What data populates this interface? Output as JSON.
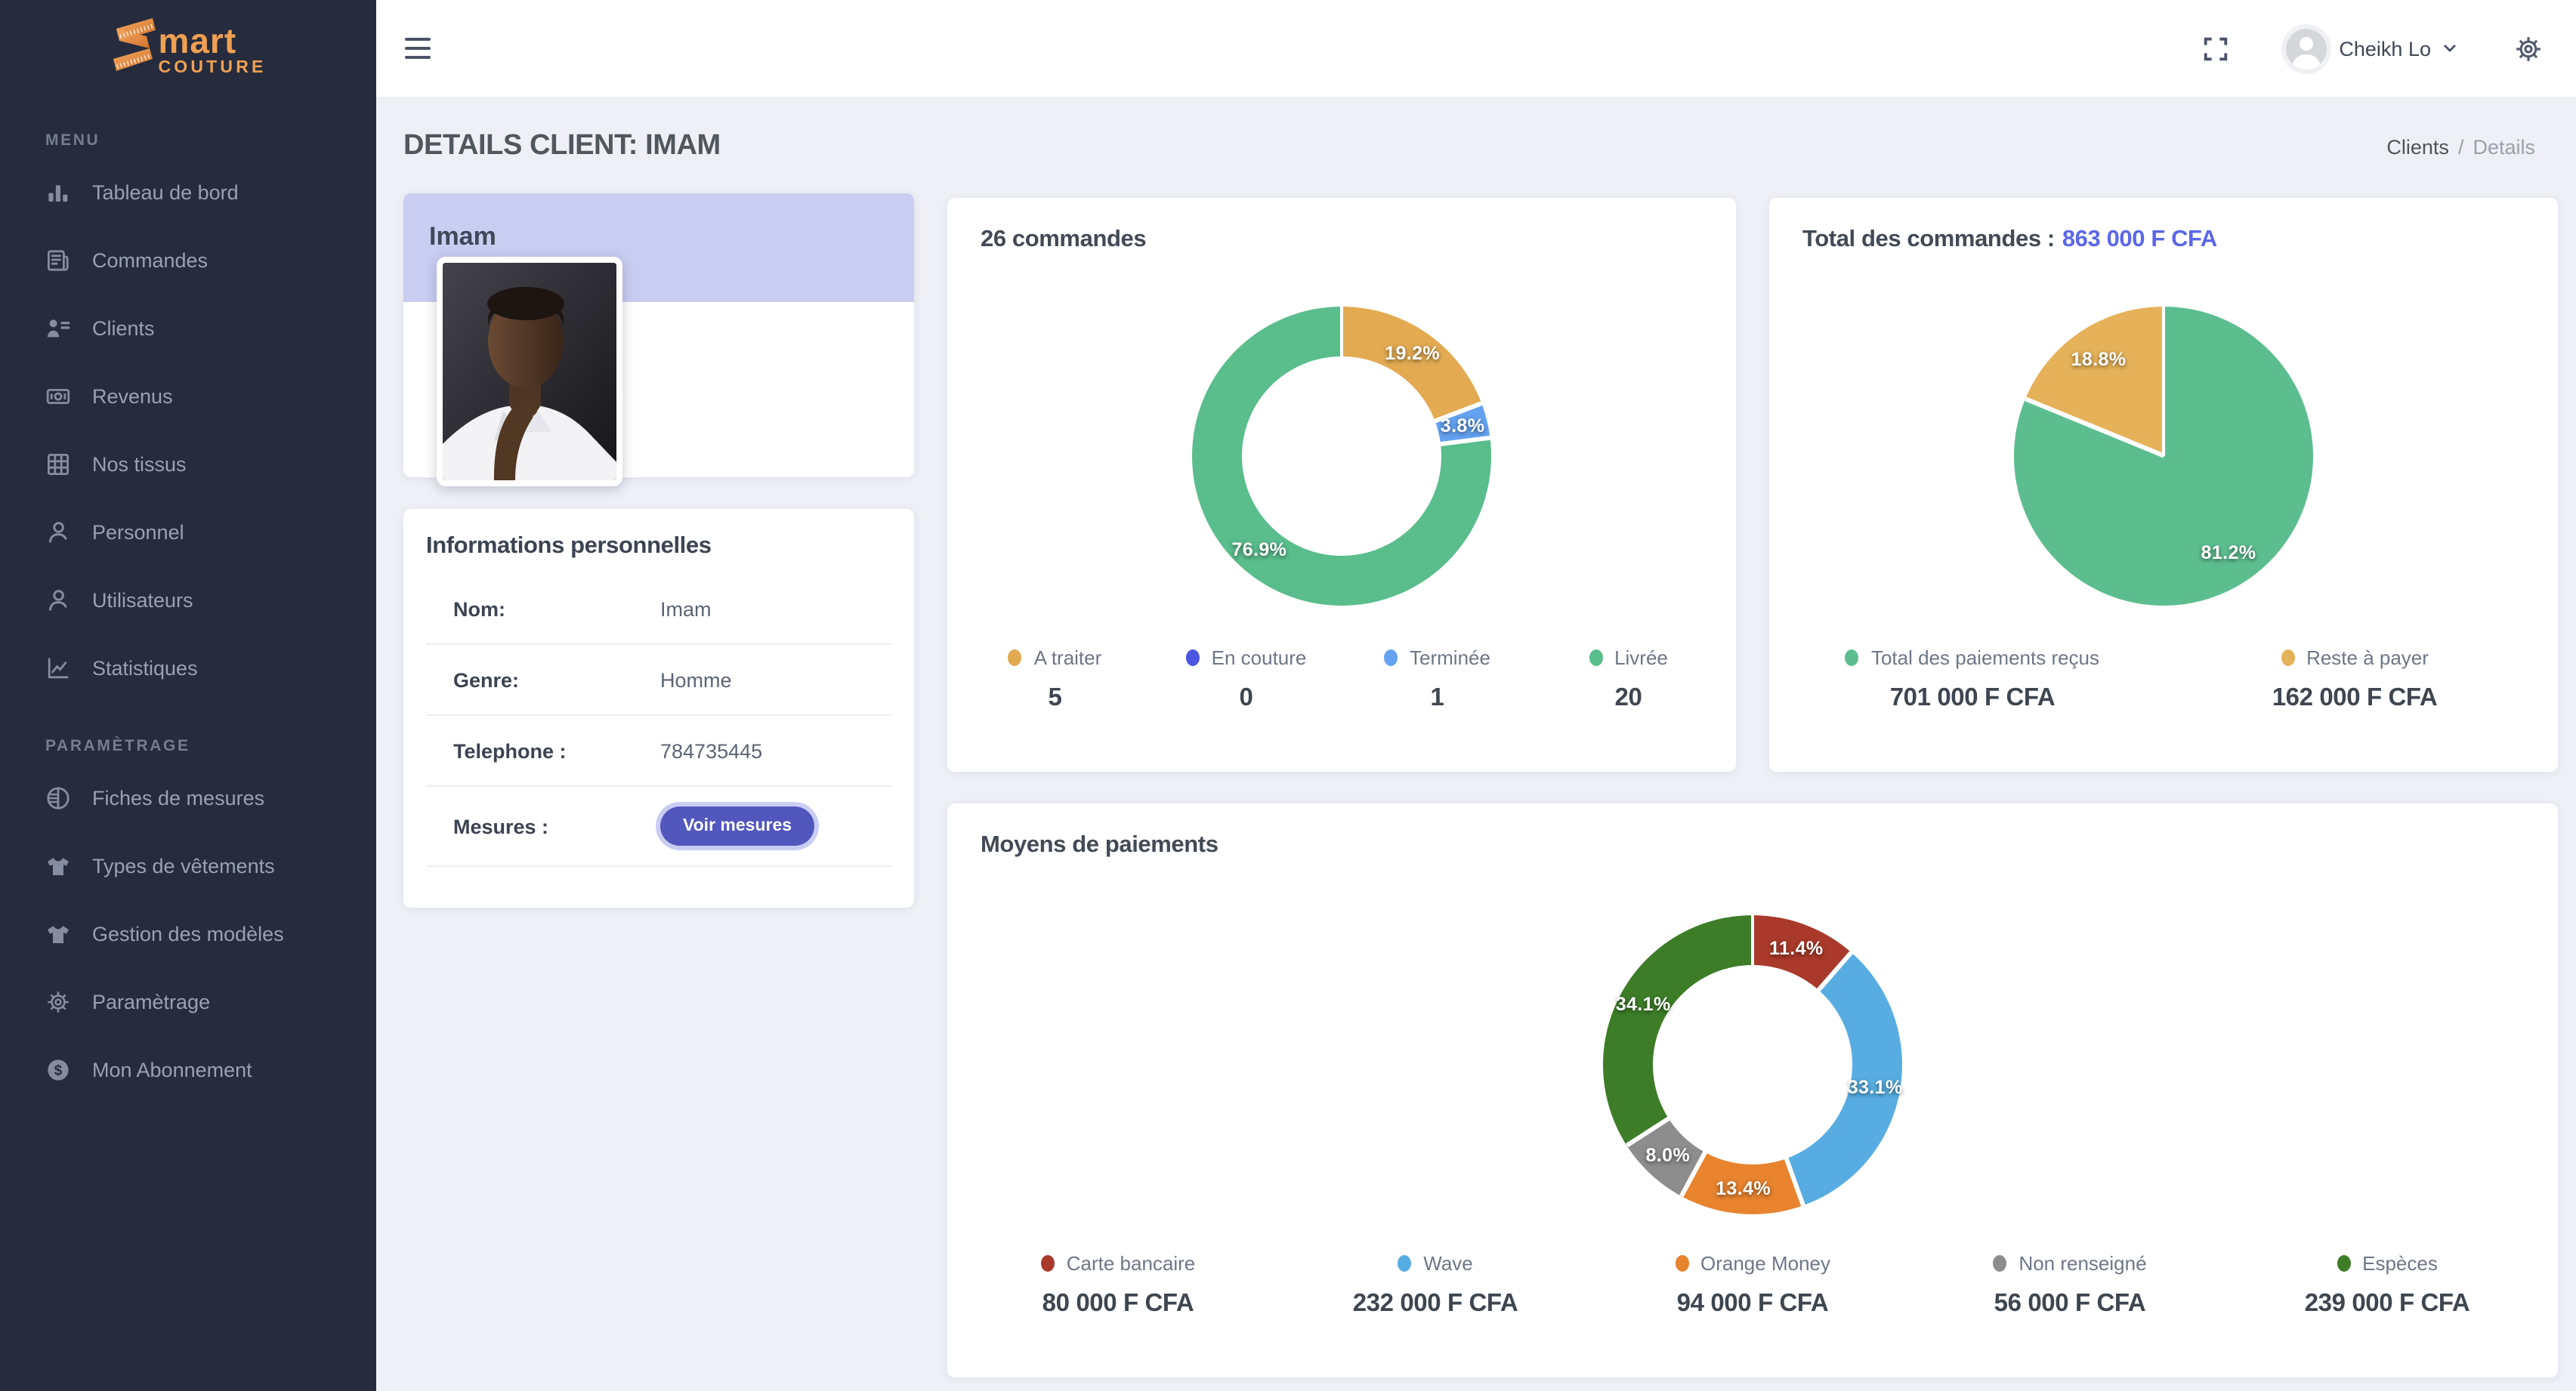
{
  "brand": {
    "name_mart": "mart",
    "name_couture": "COUTURE"
  },
  "sidebar": {
    "menu_section_label": "MENU",
    "settings_section_label": "PARAMÈTRAGE",
    "menu_items": [
      {
        "label": "Tableau de bord",
        "icon": "bar-chart-icon"
      },
      {
        "label": "Commandes",
        "icon": "orders-icon"
      },
      {
        "label": "Clients",
        "icon": "clients-icon"
      },
      {
        "label": "Revenus",
        "icon": "money-icon"
      },
      {
        "label": "Nos tissus",
        "icon": "grid-icon"
      },
      {
        "label": "Personnel",
        "icon": "person-icon"
      },
      {
        "label": "Utilisateurs",
        "icon": "users-icon"
      },
      {
        "label": "Statistiques",
        "icon": "stats-icon"
      }
    ],
    "settings_items": [
      {
        "label": "Fiches de mesures",
        "icon": "measure-icon"
      },
      {
        "label": "Types de vêtements",
        "icon": "shirt-icon"
      },
      {
        "label": "Gestion des modèles",
        "icon": "shirt-icon"
      },
      {
        "label": "Paramètrage",
        "icon": "gear-icon"
      },
      {
        "label": "Mon Abonnement",
        "icon": "dollar-icon"
      }
    ]
  },
  "topbar": {
    "user_name": "Cheikh Lo"
  },
  "page": {
    "title": "DETAILS CLIENT: IMAM",
    "breadcrumb_parent": "Clients",
    "breadcrumb_separator": "/",
    "breadcrumb_current": "Details"
  },
  "client_card": {
    "name": "Imam"
  },
  "info_card": {
    "title": "Informations personnelles",
    "rows": [
      {
        "label": "Nom:",
        "value": "Imam"
      },
      {
        "label": "Genre:",
        "value": "Homme"
      },
      {
        "label": "Telephone :",
        "value": "784735445"
      }
    ],
    "measures_label": "Mesures :",
    "measures_button": "Voir mesures"
  },
  "chart_data": [
    {
      "type": "donut",
      "title": "26 commandes",
      "legend_position": "bottom",
      "slices": [
        {
          "label": "A traiter",
          "legend_value": "5",
          "fraction": 0.192,
          "pct": "19.2%",
          "color": "#e3aa52"
        },
        {
          "label": "En couture",
          "legend_value": "0",
          "fraction": 0,
          "pct": "",
          "color": "#4b55e0"
        },
        {
          "label": "Terminée",
          "legend_value": "1",
          "fraction": 0.038,
          "pct": "3.8%",
          "color": "#64a2f1"
        },
        {
          "label": "Livrée",
          "legend_value": "20",
          "fraction": 0.77,
          "pct": "76.9%",
          "color": "#5abd8c"
        }
      ]
    },
    {
      "type": "pie",
      "title": "Total des commandes :",
      "title_amount": "863 000 F CFA",
      "legend_position": "bottom",
      "slices": [
        {
          "label": "Total des paiements reçus",
          "legend_value": "701 000 F CFA",
          "fraction": 0.812,
          "pct": "81.2%",
          "color": "#5cbe8e"
        },
        {
          "label": "Reste à payer",
          "legend_value": "162 000 F CFA",
          "fraction": 0.188,
          "pct": "18.8%",
          "color": "#e6b259"
        }
      ]
    },
    {
      "type": "donut",
      "title": "Moyens de paiements",
      "legend_position": "bottom",
      "slices": [
        {
          "label": "Carte bancaire",
          "legend_value": "80 000 F CFA",
          "fraction": 0.114,
          "pct": "11.4%",
          "color": "#a93a2b"
        },
        {
          "label": "Wave",
          "legend_value": "232 000 F CFA",
          "fraction": 0.331,
          "pct": "33.1%",
          "color": "#57ade1"
        },
        {
          "label": "Orange Money",
          "legend_value": "94 000 F CFA",
          "fraction": 0.134,
          "pct": "13.4%",
          "color": "#e8832e"
        },
        {
          "label": "Non renseigné",
          "legend_value": "56 000 F CFA",
          "fraction": 0.08,
          "pct": "8.0%",
          "color": "#8d8d8d"
        },
        {
          "label": "Espèces",
          "legend_value": "239 000 F CFA",
          "fraction": 0.341,
          "pct": "34.1%",
          "color": "#3d7d28"
        }
      ]
    }
  ]
}
